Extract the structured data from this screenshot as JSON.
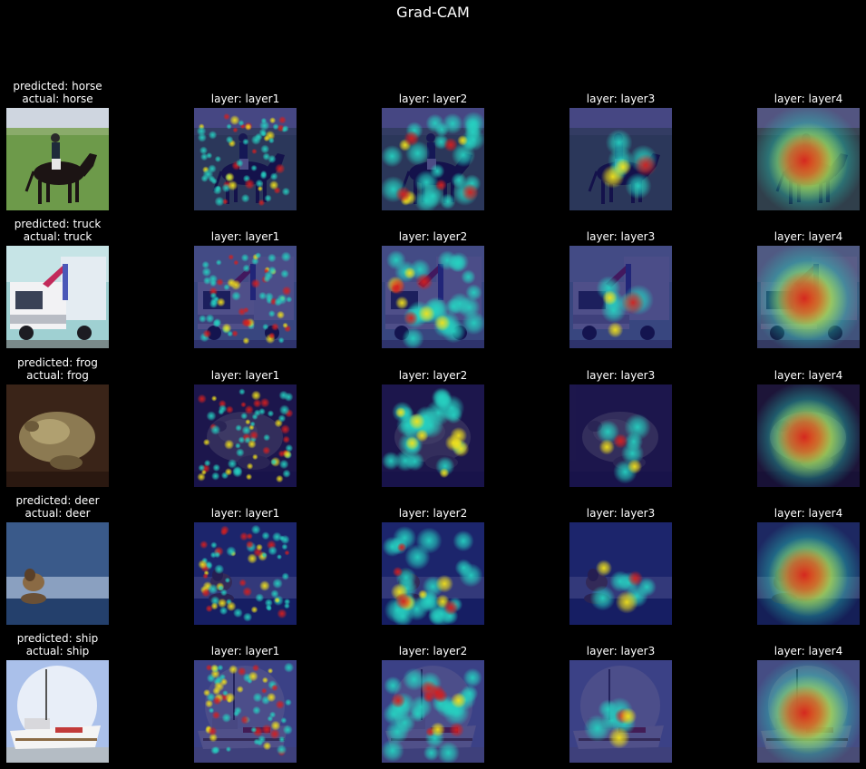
{
  "figure": {
    "title": "Grad-CAM"
  },
  "rows": [
    {
      "label": "horse",
      "scene": "horse",
      "title_lines": [
        "predicted: horse",
        "actual: horse"
      ],
      "layer_titles": [
        "layer: layer1",
        "layer: layer2",
        "layer: layer3",
        "layer: layer4"
      ]
    },
    {
      "label": "truck",
      "scene": "truck",
      "title_lines": [
        "predicted: truck",
        "actual: truck"
      ],
      "layer_titles": [
        "layer: layer1",
        "layer: layer2",
        "layer: layer3",
        "layer: layer4"
      ]
    },
    {
      "label": "frog",
      "scene": "frog",
      "title_lines": [
        "predicted: frog",
        "actual: frog"
      ],
      "layer_titles": [
        "layer: layer1",
        "layer: layer2",
        "layer: layer3",
        "layer: layer4"
      ]
    },
    {
      "label": "deer",
      "scene": "deer",
      "title_lines": [
        "predicted: deer",
        "actual: deer"
      ],
      "layer_titles": [
        "layer: layer1",
        "layer: layer2",
        "layer: layer3",
        "layer: layer4"
      ]
    },
    {
      "label": "ship",
      "scene": "ship",
      "title_lines": [
        "predicted: ship",
        "actual: ship"
      ],
      "layer_titles": [
        "layer: layer1",
        "layer: layer2",
        "layer: layer3",
        "layer: layer4"
      ]
    }
  ],
  "colors": {
    "background": "#000000",
    "text": "#ffffff",
    "heat_cold": "#1a1a8c",
    "heat_mid": "#26d0c0",
    "heat_warm": "#f2e21c",
    "heat_hot": "#d41f1f"
  }
}
